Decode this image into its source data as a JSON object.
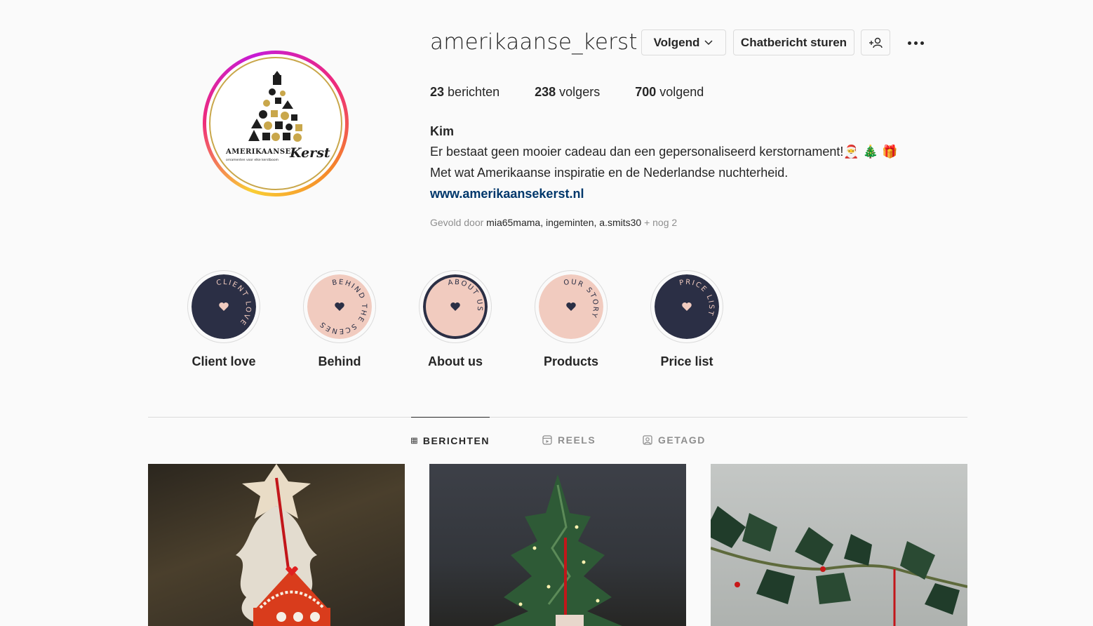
{
  "profile": {
    "username": "amerikaanse_kerst",
    "follow_label": "Volgend",
    "message_label": "Chatbericht sturen",
    "avatar_text": "AMERIKAANSE Kerst",
    "avatar_subtext": "ornamenten voor elke kerstboom",
    "stats": {
      "posts_count": "23",
      "posts_label": "berichten",
      "followers_count": "238",
      "followers_label": "volgers",
      "following_count": "700",
      "following_label": "volgend"
    },
    "bio": {
      "name": "Kim",
      "line1": "Er bestaat geen mooier cadeau dan een gepersonaliseerd kerstornament!🎅 🎄 🎁",
      "line2": "Met wat Amerikaanse inspiratie en de Nederlandse nuchterheid.",
      "link": "www.amerikaansekerst.nl"
    },
    "followed_by": {
      "prefix": "Gevold door",
      "users": [
        "mia65mama",
        "ingeminten",
        "a.smits30"
      ],
      "more": "+ nog 2"
    }
  },
  "highlights": [
    {
      "label": "Client love",
      "ring_text": "CLIENT LOVE",
      "bg": "#2b2f45",
      "fg": "#f1cbbf"
    },
    {
      "label": "Behind",
      "ring_text": "BEHIND THE SCENES",
      "bg": "#f1cbbf",
      "fg": "#2b2f45"
    },
    {
      "label": "About us",
      "ring_text": "ABOUT US",
      "bg": "#f1cbbf",
      "fg": "#2b2f45"
    },
    {
      "label": "Products",
      "ring_text": "OUR STORY",
      "bg": "#f1cbbf",
      "fg": "#2b2f45"
    },
    {
      "label": "Price list",
      "ring_text": "PRICE LIST",
      "bg": "#2b2f45",
      "fg": "#f1cbbf"
    }
  ],
  "tabs": [
    {
      "label": "BERICHTEN",
      "icon": "grid-icon",
      "active": true
    },
    {
      "label": "REELS",
      "icon": "reels-icon",
      "active": false
    },
    {
      "label": "GETAGD",
      "icon": "tagged-icon",
      "active": false
    }
  ],
  "colors": {
    "link": "#00376b",
    "text": "#262626",
    "muted": "#8e8e8e",
    "border": "#dbdbdb",
    "highlight_navy": "#2b2f45",
    "highlight_pink": "#f1cbbf"
  }
}
